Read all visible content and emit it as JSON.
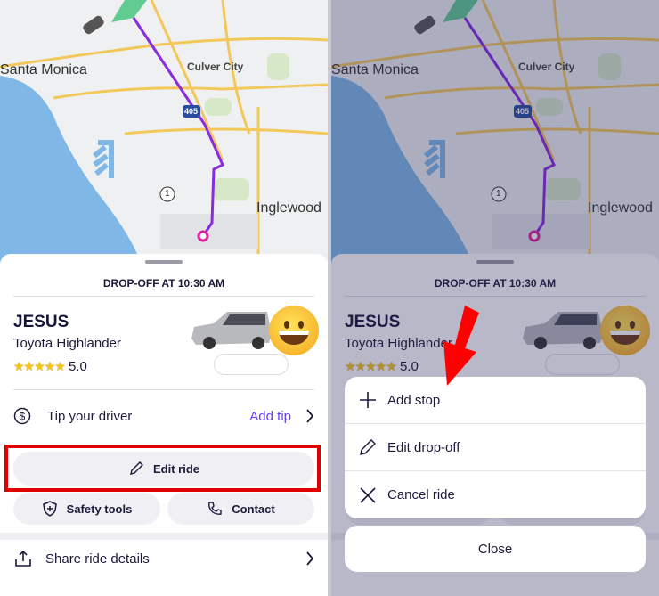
{
  "map": {
    "labels": {
      "santa_monica": "Santa Monica",
      "culver_city": "Culver City",
      "inglewood": "Inglewood",
      "highway_405": "405",
      "route_1": "1"
    }
  },
  "sheet": {
    "dropoff": "DROP-OFF AT 10:30 AM",
    "driver_name": "JESUS",
    "car_model": "Toyota Highlander",
    "stars": "★★★★★",
    "rating": "5.0",
    "tip_label": "Tip your driver",
    "add_tip": "Add tip",
    "edit_ride": "Edit ride",
    "safety_tools": "Safety tools",
    "contact": "Contact",
    "share": "Share ride details"
  },
  "menu": {
    "items": [
      {
        "label": "Add stop",
        "icon": "plus-icon"
      },
      {
        "label": "Edit drop-off",
        "icon": "pencil-icon"
      },
      {
        "label": "Cancel ride",
        "icon": "x-icon"
      }
    ],
    "close": "Close"
  },
  "colors": {
    "accent": "#6a3ef5",
    "route": "#8a2be2",
    "highlight": "#e00000"
  }
}
